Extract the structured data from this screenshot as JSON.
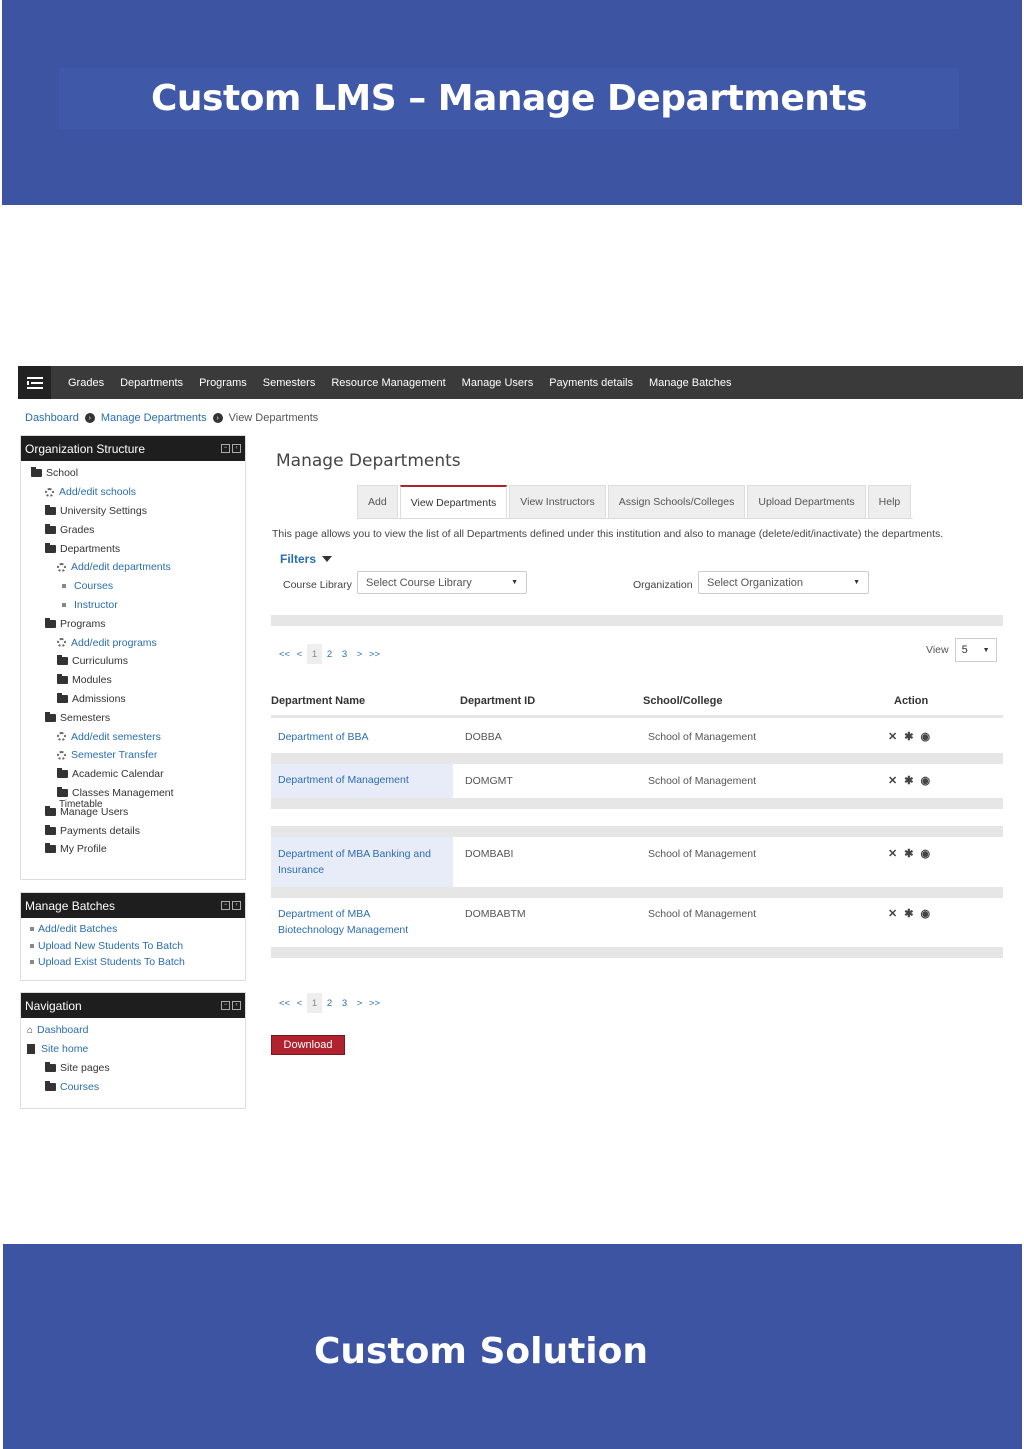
{
  "banner_title": "Custom LMS – Manage Departments",
  "footer_title": "Custom Solution",
  "navbar": {
    "items": [
      "Grades",
      "Departments",
      "Programs",
      "Semesters",
      "Resource Management",
      "Manage Users",
      "Payments details",
      "Manage Batches"
    ]
  },
  "breadcrumb": {
    "dashboard": "Dashboard",
    "manage": "Manage Departments",
    "current": "View Departments"
  },
  "org_block": {
    "title": "Organization Structure",
    "items": {
      "school": "School",
      "add_schools": "Add/edit schools",
      "university_settings": "University Settings",
      "grades": "Grades",
      "departments": "Departments",
      "add_departments": "Add/edit departments",
      "courses": "Courses",
      "instructor": "Instructor",
      "programs": "Programs",
      "add_programs": "Add/edit programs",
      "curriculums": "Curriculums",
      "modules": "Modules",
      "admissions": "Admissions",
      "semesters": "Semesters",
      "add_semesters": "Add/edit semesters",
      "semester_transfer": "Semester Transfer",
      "academic_calendar": "Academic Calendar",
      "classes_management": "Classes Management",
      "timetable": "Timetable",
      "manage_users": "Manage Users",
      "payments": "Payments details",
      "profile": "My Profile"
    }
  },
  "batch_block": {
    "title": "Manage Batches",
    "items": [
      "Add/edit Batches",
      "Upload New Students To Batch",
      "Upload Exist Students To Batch"
    ]
  },
  "nav_block": {
    "title": "Navigation",
    "dashboard": "Dashboard",
    "site_home": "Site home",
    "site_pages": "Site pages",
    "courses": "Courses"
  },
  "main": {
    "heading": "Manage Departments",
    "tabs": [
      "Add",
      "View Departments",
      "View Instructors",
      "Assign Schools/Colleges",
      "Upload Departments",
      "Help"
    ],
    "description": "This page allows you to view the list of all Departments defined under this institution and also to manage (delete/edit/inactivate) the departments.",
    "filters_label": "Filters",
    "course_library_label": "Course Library",
    "course_library_value": "Select Course Library",
    "organization_label": "Organization",
    "organization_value": "Select Organization",
    "pager": [
      "<<",
      "<",
      "1",
      "2",
      "3",
      ">",
      ">>"
    ],
    "view_label": "View",
    "view_value": "5",
    "columns": [
      "Department Name",
      "Department ID",
      "School/College",
      "Action"
    ],
    "rows": [
      {
        "name": "Department of BBA",
        "id": "DOBBA",
        "school": "School of Management"
      },
      {
        "name": "Department of Management",
        "id": "DOMGMT",
        "school": "School of Management"
      },
      {
        "name": "Department of MBA Banking and Insurance",
        "id": "DOMBABI",
        "school": "School of Management"
      },
      {
        "name": "Department of MBA Biotechnology Management",
        "id": "DOMBABTM",
        "school": "School of Management"
      }
    ],
    "download_label": "Download"
  },
  "icons": {
    "delete": "close-icon",
    "settings": "gear-icon",
    "view": "eye-icon"
  }
}
